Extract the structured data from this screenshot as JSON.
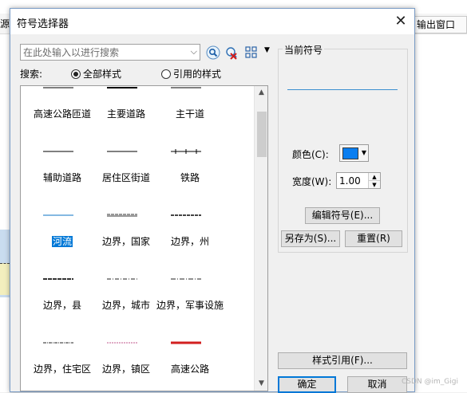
{
  "background": {
    "left_tab_text": "源",
    "right_tab_text": "输出窗口"
  },
  "dialog": {
    "title": "符号选择器",
    "close_glyph": "✕"
  },
  "search": {
    "placeholder": "在此处输入以进行搜索",
    "label": "搜索:",
    "scope_all": "全部样式",
    "scope_referenced": "引用的样式",
    "selected_scope": "全部样式"
  },
  "icons": [
    "search-icon",
    "clear-search-icon",
    "view-options-icon"
  ],
  "symbols": [
    {
      "label": "高速公路匝道",
      "style": "solid-dark"
    },
    {
      "label": "主要道路",
      "style": "solid-bold"
    },
    {
      "label": "主干道",
      "style": "solid-thin"
    },
    {
      "label": "辅助道路",
      "style": "solid-thin"
    },
    {
      "label": "居住区街道",
      "style": "solid-thin"
    },
    {
      "label": "铁路",
      "style": "railroad"
    },
    {
      "label": "河流",
      "style": "river",
      "selected": true
    },
    {
      "label": "边界，国家",
      "style": "boundary-double"
    },
    {
      "label": "边界，州",
      "style": "boundary-dash"
    },
    {
      "label": "边界，县",
      "style": "boundary-dash-bold"
    },
    {
      "label": "边界，城市",
      "style": "boundary-dot"
    },
    {
      "label": "边界，军事设施",
      "style": "boundary-dashdot"
    },
    {
      "label": "边界，住宅区",
      "style": "boundary-dot-small"
    },
    {
      "label": "边界，镇区",
      "style": "boundary-pink"
    },
    {
      "label": "高速公路",
      "style": "highway-red"
    }
  ],
  "current_symbol": {
    "title": "当前符号",
    "preview_color": "#3c8fd0",
    "color_label": "颜色(C):",
    "color_value": "#0a7ef0",
    "width_label": "宽度(W):",
    "width_value": "1.00",
    "edit_button": "编辑符号(E)...",
    "save_as_button": "另存为(S)...",
    "reset_button": "重置(R)"
  },
  "buttons": {
    "style_reference": "样式引用(F)...",
    "ok": "确定",
    "cancel": "取消"
  },
  "watermark": "CSDN @im_Gigi"
}
